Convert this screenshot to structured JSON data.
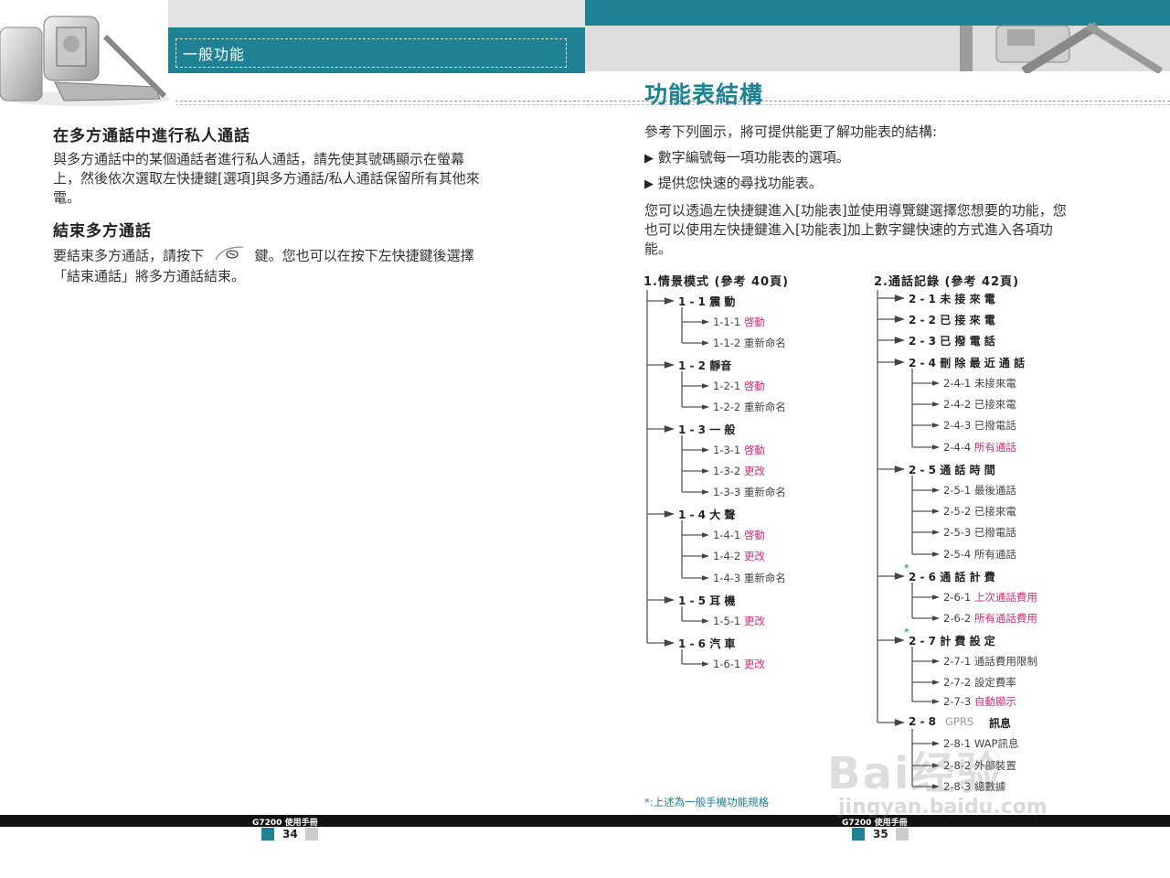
{
  "header": {
    "section_label": "一般功能",
    "page_title": "功能表結構"
  },
  "left": {
    "sec1_title": "在多方通話中進行私人通話",
    "sec1_body": [
      "與多方通話中的某個通話者進行私人通話，請先使其號碼顯示在螢幕",
      "上，然後依次選取左快捷鍵[選項]與多方通話/私人通話保留所有其他來",
      "電。"
    ],
    "sec2_title": "結束多方通話",
    "sec2_body_a": "要結束多方通話，請按下",
    "sec2_body_b": "鍵。您也可以在按下左快捷鍵後選擇",
    "sec2_body_c": "「結束通話」將多方通話結束。"
  },
  "right": {
    "intro": "參考下列圖示，將可提供能更了解功能表的結構:",
    "bullets": [
      "數字編號每一項功能表的選項。",
      "提供您快速的尋找功能表。"
    ],
    "body": [
      "您可以透過左快捷鍵進入[功能表]並使用導覽鍵選擇您想要的功能，您",
      "也可以使用左快捷鍵進入[功能表]加上數字鍵快速的方式進入各項功",
      "能。"
    ],
    "footnote": "*:上述為一般手機功能規格"
  },
  "tree1": {
    "title": "1.情景模式  (參考  40頁)",
    "items": [
      {
        "label": "1 - 1  震 動",
        "subs": [
          {
            "num": "1-1-1",
            "text": "啓動",
            "pink": true
          },
          {
            "num": "1-1-2",
            "text": "重新命名",
            "pink": false
          }
        ]
      },
      {
        "label": "1 - 2   靜音",
        "subs": [
          {
            "num": "1-2-1",
            "text": "啓動",
            "pink": true
          },
          {
            "num": "1-2-2",
            "text": "重新命名",
            "pink": false
          }
        ]
      },
      {
        "label": "1 - 3  一 般",
        "subs": [
          {
            "num": "1-3-1",
            "text": "啓動",
            "pink": true
          },
          {
            "num": "1-3-2",
            "text": "更改",
            "pink": true
          },
          {
            "num": "1-3-3",
            "text": "重新命名",
            "pink": false
          }
        ]
      },
      {
        "label": "1 - 4  大 聲",
        "subs": [
          {
            "num": "1-4-1",
            "text": "啓動",
            "pink": true
          },
          {
            "num": "1-4-2",
            "text": "更改",
            "pink": true
          },
          {
            "num": "1-4-3",
            "text": "重新命名",
            "pink": false
          }
        ]
      },
      {
        "label": "1 - 5  耳 機",
        "subs": [
          {
            "num": "1-5-1",
            "text": "更改",
            "pink": true
          }
        ]
      },
      {
        "label": "1 - 6  汽 車",
        "subs": [
          {
            "num": "1-6-1",
            "text": "更改",
            "pink": true
          }
        ]
      }
    ]
  },
  "tree2": {
    "title": "2.通話記錄  (參考  42頁)",
    "items": [
      {
        "label": "2 - 1  未 接 來 電",
        "subs": []
      },
      {
        "label": "2 - 2  已 接 來 電",
        "subs": []
      },
      {
        "label": "2 - 3  已 撥 電 話",
        "subs": []
      },
      {
        "label": "2 - 4  刪 除 最 近 通 話",
        "subs": [
          {
            "num": "2-4-1",
            "text": "未接來電",
            "pink": false
          },
          {
            "num": "2-4-2",
            "text": "已接來電",
            "pink": false
          },
          {
            "num": "2-4-3",
            "text": "已撥電話",
            "pink": false
          },
          {
            "num": "2-4-4",
            "text": "所有通話",
            "pink": true
          }
        ]
      },
      {
        "label": "2 - 5  通 話 時 間",
        "subs": [
          {
            "num": "2-5-1",
            "text": "最後通話",
            "pink": false
          },
          {
            "num": "2-5-2",
            "text": "已接來電",
            "pink": false
          },
          {
            "num": "2-5-3",
            "text": "已撥電話",
            "pink": false
          },
          {
            "num": "2-5-4",
            "text": "所有通話",
            "pink": false
          }
        ]
      },
      {
        "label": "2 - 6  通 話 計 費",
        "star": "*",
        "subs": [
          {
            "num": "2-6-1",
            "text": "上次通話費用",
            "pink": true
          },
          {
            "num": "2-6-2",
            "text": "所有通話費用",
            "pink": true
          }
        ]
      },
      {
        "label": "2 - 7  計 費 設 定",
        "star": "*",
        "subs": [
          {
            "num": "2-7-1",
            "text": "通話費用限制",
            "pink": false
          },
          {
            "num": "2-7-2",
            "text": "設定費率",
            "pink": false
          },
          {
            "num": "2-7-3",
            "text": "自動顯示",
            "pink": true
          }
        ]
      },
      {
        "label": "2 - 8",
        "label_gray": "GPRS",
        "label_tail": "訊息",
        "subs": [
          {
            "num": "2-8-1",
            "text": "WAP訊息",
            "pink": false
          },
          {
            "num": "2-8-2",
            "text": "外部裝置",
            "pink": false
          },
          {
            "num": "2-8-3",
            "text": "總數據",
            "pink": false
          }
        ]
      }
    ]
  },
  "footer": {
    "manual_left": "G7200 使用手冊",
    "page_left": "34",
    "manual_right": "G7200 使用手冊",
    "page_right": "35"
  },
  "watermark": {
    "main": "Bai经验",
    "sub": "jingyan.baidu.com"
  },
  "colors": {
    "teal": "#1f8294",
    "pink": "#d0307a"
  }
}
